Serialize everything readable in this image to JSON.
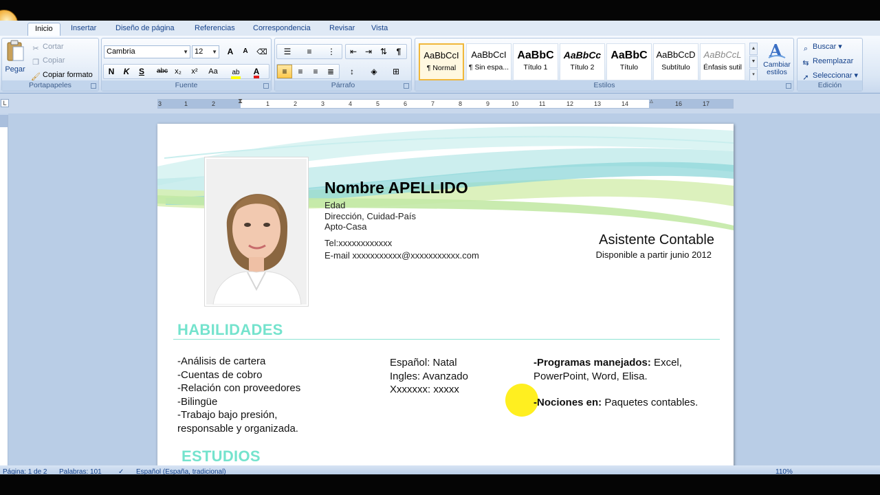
{
  "tabs": [
    "Inicio",
    "Insertar",
    "Diseño de página",
    "Referencias",
    "Correspondencia",
    "Revisar",
    "Vista"
  ],
  "clipboard": {
    "paste": "Pegar",
    "cut": "Cortar",
    "copy": "Copiar",
    "format_painter": "Copiar formato",
    "label": "Portapapeles"
  },
  "font": {
    "name": "Cambria",
    "size": "12",
    "label": "Fuente",
    "buttons": {
      "grow": "A",
      "shrink": "A",
      "bold": "N",
      "italic": "K",
      "underline": "S",
      "strike": "abc",
      "sub": "x₂",
      "sup": "x²",
      "case": "Aa",
      "color": "A"
    }
  },
  "paragraph": {
    "label": "Párrafo"
  },
  "styles": {
    "label": "Estilos",
    "items": [
      {
        "sample": "AaBbCcI",
        "name": "¶ Normal"
      },
      {
        "sample": "AaBbCcI",
        "name": "¶ Sin espa..."
      },
      {
        "sample": "AaBbC",
        "name": "Título 1"
      },
      {
        "sample": "AaBbCc",
        "name": "Título 2"
      },
      {
        "sample": "AaBbC",
        "name": "Título"
      },
      {
        "sample": "AaBbCcD",
        "name": "Subtítulo"
      },
      {
        "sample": "AaBbCcL",
        "name": "Énfasis sutil"
      }
    ],
    "change_styles": "Cambiar estilos"
  },
  "editing": {
    "label": "Edición",
    "find": "Buscar",
    "replace": "Reemplazar",
    "select": "Seleccionar"
  },
  "ruler": {
    "ticks": [
      "3",
      "1",
      "2",
      "1",
      "1",
      "2",
      "3",
      "4",
      "5",
      "6",
      "7",
      "8",
      "9",
      "10",
      "11",
      "12",
      "13",
      "14",
      "15",
      "16",
      "17"
    ]
  },
  "resume": {
    "name": "Nombre APELLIDO",
    "age": "Edad",
    "address": "Dirección, Cuidad-País",
    "apt": "Apto-Casa",
    "tel": "Tel:xxxxxxxxxxxx",
    "email": "E-mail xxxxxxxxxxx@xxxxxxxxxxx.com",
    "job_title": "Asistente Contable",
    "availability": "Disponible  a partir junio 2012",
    "skills_heading": "HABILIDADES",
    "skills": [
      "-Análisis de cartera",
      "-Cuentas de cobro",
      "-Relación con proveedores",
      "-Bilingüe",
      "-Trabajo bajo presión,",
      "responsable y organizada."
    ],
    "languages": [
      "Español: Natal",
      "Ingles: Avanzado",
      "Xxxxxxx: xxxxx"
    ],
    "programs_label": "-Programas manejados:",
    "programs_value": " Excel,",
    "programs_value2": "PowerPoint, Word, Elisa.",
    "notions_label": "-Nociones en:",
    "notions_value": " Paquetes contables.",
    "studies_heading": "ESTUDIOS"
  },
  "status": {
    "page": "Página: 1 de 2",
    "words": "Palabras: 101",
    "language": "Español (España, tradicional)",
    "zoom": "110%"
  },
  "colors": {
    "accent_heading": "#74e3cd",
    "ribbon_text": "#15428b",
    "highlight": "#ffee14"
  }
}
